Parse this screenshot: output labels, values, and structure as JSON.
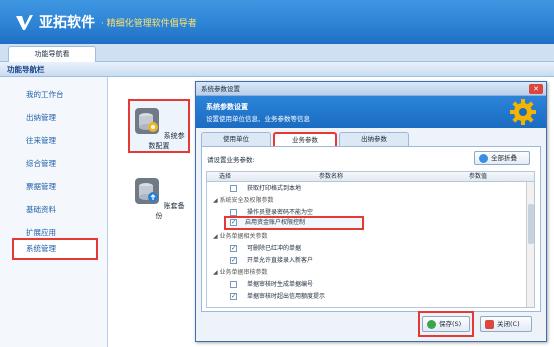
{
  "app": {
    "logo_text": "亚拓软件",
    "slogan": "· 精细化管理软件倡导者",
    "colors": {
      "brand": "#2d84d6",
      "slogan": "#ffe36a",
      "highlight": "#e53935"
    }
  },
  "top_tab": {
    "label": "功能导航看"
  },
  "sidebar": {
    "title": "功能导航栏",
    "items": [
      {
        "label": "我的工作台"
      },
      {
        "label": "出纳管理"
      },
      {
        "label": "往来管理"
      },
      {
        "label": "综合管理"
      },
      {
        "label": "票据管理"
      },
      {
        "label": "基础资料"
      },
      {
        "label": "扩展应用"
      },
      {
        "label": "系统管理"
      }
    ]
  },
  "desktop": {
    "icons": [
      {
        "label": "系统参数配置",
        "icon": "gear-database-icon"
      },
      {
        "label": "账套备份",
        "icon": "database-backup-icon"
      }
    ]
  },
  "dialog": {
    "title": "系统参数设置",
    "close_label": "✕",
    "hero_title": "系统参数设置",
    "hero_subtitle": "设置使用单位信息、业务参数等信息",
    "tabs": [
      {
        "label": "使用单位"
      },
      {
        "label": "业务参数"
      },
      {
        "label": "出纳参数"
      }
    ],
    "prompt": "请设置业务参数:",
    "collapse_label": "全部折叠",
    "grid": {
      "headers": {
        "select": "选择",
        "name": "参数名称",
        "value": "参数值"
      },
      "rows": [
        {
          "type": "item",
          "checked": false,
          "label": "获取打印格式到本地"
        },
        {
          "type": "group",
          "label": "◢ 系统安全及权限参数"
        },
        {
          "type": "item",
          "checked": false,
          "label": "操作员登录密码不能为空"
        },
        {
          "type": "item",
          "checked": true,
          "label": "启用资金账户权限控制"
        },
        {
          "type": "group",
          "label": "◢ 业务单据相关参数"
        },
        {
          "type": "item",
          "checked": true,
          "label": "可删除已红冲的单据"
        },
        {
          "type": "item",
          "checked": true,
          "label": "开单允许直接录入新客户"
        },
        {
          "type": "group",
          "label": "◢ 业务单据审核参数"
        },
        {
          "type": "item",
          "checked": false,
          "label": "单据审核时生成单据编号"
        },
        {
          "type": "item",
          "checked": true,
          "label": "单据审核时超出信用额度提示"
        }
      ]
    },
    "save_label": "保存(S)",
    "close_button_label": "关闭(C)"
  }
}
